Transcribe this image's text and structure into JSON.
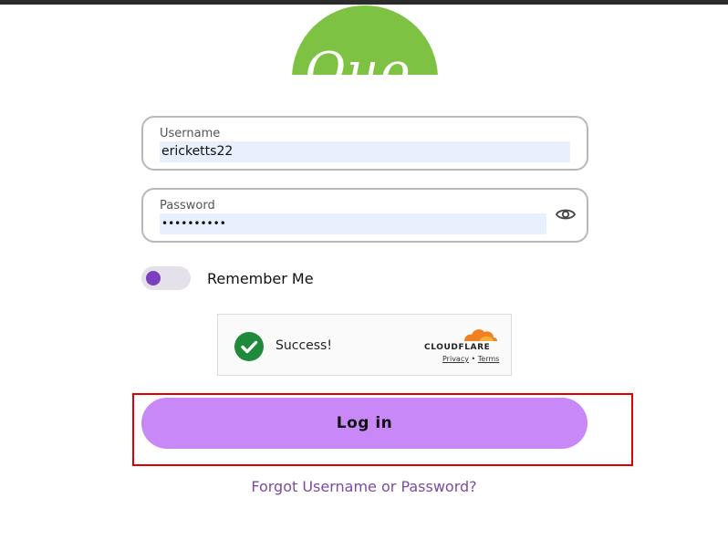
{
  "logo": {
    "text": "Quo",
    "color": "#7dc242"
  },
  "username": {
    "label": "Username",
    "value": "ericketts22"
  },
  "password": {
    "label": "Password",
    "value": "••••••••••",
    "toggle_icon": "eye-icon"
  },
  "remember": {
    "label": "Remember Me",
    "checked": true,
    "knob_color": "#7b3fbf"
  },
  "captcha": {
    "status": "Success!",
    "provider": "CLOUDFLARE",
    "privacy_label": "Privacy",
    "separator": "•",
    "terms_label": "Terms",
    "check_color": "#1e8a3a"
  },
  "login_button": {
    "label": "Log in",
    "color": "#c888f8"
  },
  "forgot_link": {
    "label": "Forgot Username or Password?"
  },
  "accent_colors": {
    "highlight": "#e00000",
    "link": "#7b4aa6"
  }
}
